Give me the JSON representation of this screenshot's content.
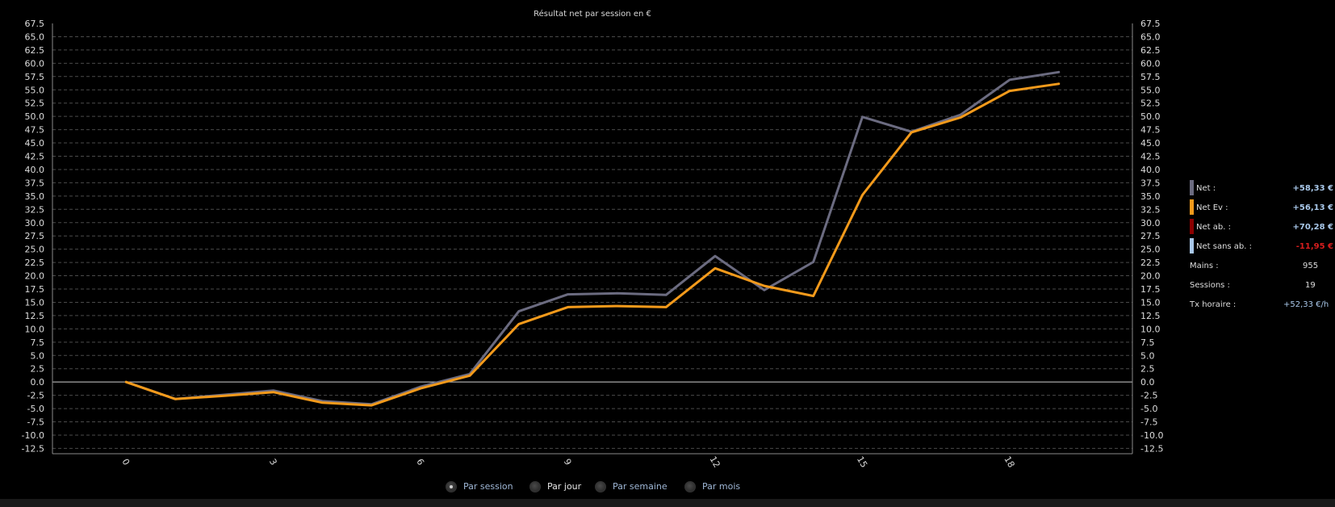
{
  "chart_data": {
    "type": "line",
    "title": "Résultat net par session en €",
    "xlabel": "",
    "ylabel": "",
    "x": [
      0,
      1,
      2,
      3,
      4,
      5,
      6,
      7,
      8,
      9,
      10,
      11,
      12,
      13,
      14,
      15,
      16,
      17,
      18,
      19
    ],
    "x_ticks": [
      "0",
      "3",
      "6",
      "9",
      "12",
      "15",
      "18"
    ],
    "x_tick_values": [
      0,
      3,
      6,
      9,
      12,
      15,
      18
    ],
    "xlim": [
      -1.5,
      20.5
    ],
    "ylim": [
      -13.5,
      67.5
    ],
    "y_tick_labels": [
      "67.5",
      "65.0",
      "62.5",
      "60.0",
      "57.5",
      "55.0",
      "52.5",
      "50.0",
      "47.5",
      "45.0",
      "42.5",
      "40.0",
      "37.5",
      "35.0",
      "32.5",
      "30.0",
      "27.5",
      "25.0",
      "22.5",
      "20.0",
      "17.5",
      "15.0",
      "12.5",
      "10.0",
      "7.5",
      "5.0",
      "2.5",
      "0.0",
      "-2.5",
      "-5.0",
      "-7.5",
      "-10.0",
      "-12.5"
    ],
    "grid": true,
    "legend": "right",
    "series": [
      {
        "name": "Net",
        "color": "#6b6b80",
        "values": [
          0,
          -3.2,
          -2.4,
          -1.6,
          -3.6,
          -4.2,
          -0.9,
          1.5,
          13.3,
          16.5,
          16.7,
          16.4,
          23.7,
          17.3,
          22.6,
          49.9,
          47.1,
          50.3,
          56.9,
          58.33
        ]
      },
      {
        "name": "Net Ev",
        "color": "#f39a1b",
        "values": [
          0,
          -3.2,
          -2.6,
          -1.9,
          -3.9,
          -4.4,
          -1.2,
          1.2,
          10.9,
          14.1,
          14.3,
          14.1,
          21.4,
          18.1,
          16.2,
          35.2,
          47.0,
          49.8,
          54.8,
          56.13
        ]
      }
    ]
  },
  "legend": {
    "items": [
      {
        "label": "Net :",
        "value": "+58,33 €",
        "color": "#6b6b80",
        "value_color": "#a9c8ea"
      },
      {
        "label": "Net Ev :",
        "value": "+56,13 €",
        "color": "#f39a1b",
        "value_color": "#a9c8ea"
      },
      {
        "label": "Net ab. :",
        "value": "+70,28 €",
        "color": "#8b0000",
        "value_color": "#a9c8ea"
      },
      {
        "label": "Net sans ab. :",
        "value": "-11,95 €",
        "color": "#a9c8ea",
        "value_color": "#d81e1e"
      }
    ],
    "stats": [
      {
        "label": "Mains :",
        "value": "955"
      },
      {
        "label": "Sessions :",
        "value": "19"
      },
      {
        "label": "Tx horaire :",
        "value": "+52,33 €/h",
        "value_color": "#a9c8ea"
      }
    ]
  },
  "controls": {
    "options": [
      {
        "label": "Par session",
        "selected": true,
        "color": "#9fb7d6"
      },
      {
        "label": "Par jour",
        "selected": false,
        "color": "#e6e6e6"
      },
      {
        "label": "Par semaine",
        "selected": false,
        "color": "#9fb7d6"
      },
      {
        "label": "Par mois",
        "selected": false,
        "color": "#9fb7d6"
      }
    ]
  }
}
